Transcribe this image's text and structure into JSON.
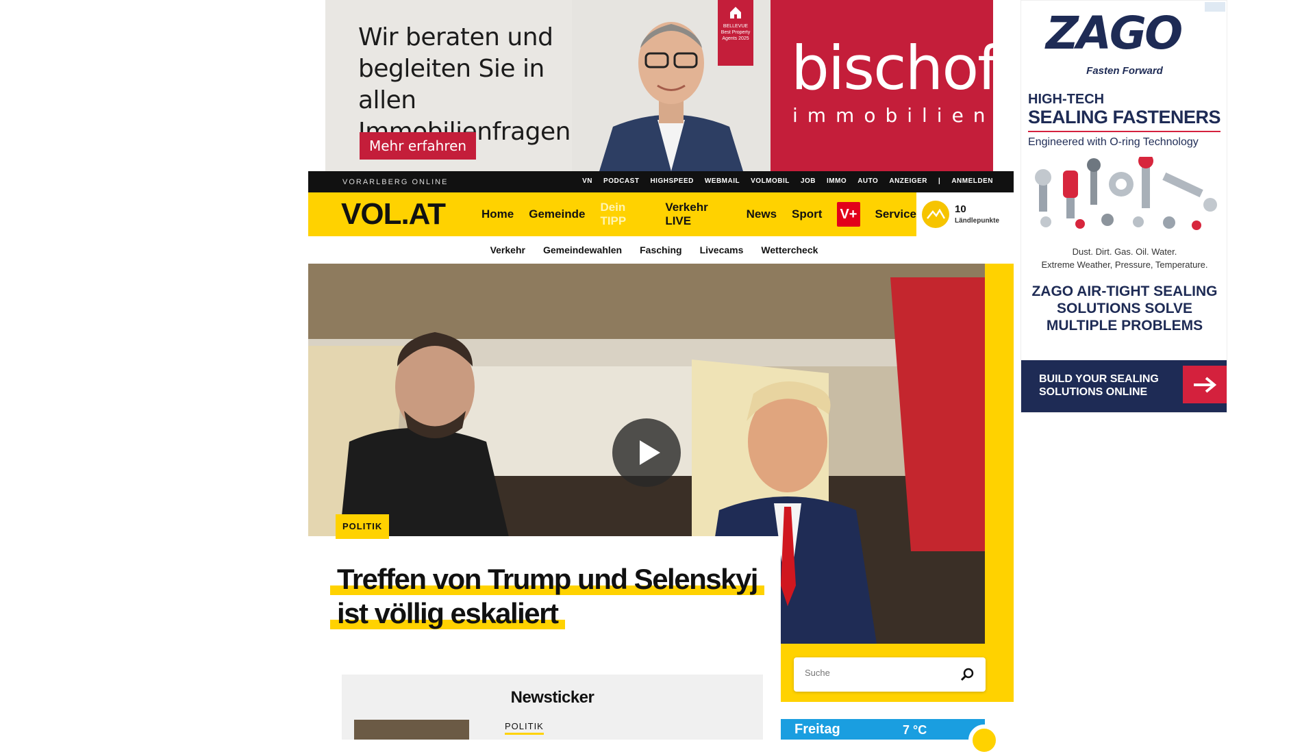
{
  "top_ad": {
    "text": "Wir beraten und begleiten Sie in allen Immobilienfragen.",
    "cta": "Mehr erfahren",
    "badge": "BELLEVUE Best Property Agents 2025",
    "brand_name": "bischof",
    "brand_sub": "immobilien"
  },
  "topbar": {
    "site_label": "VORARLBERG ONLINE",
    "links": [
      "VN",
      "PODCAST",
      "HIGHSPEED",
      "WEBMAIL",
      "VOLMOBIL",
      "JOB",
      "IMMO",
      "AUTO",
      "ANZEIGER"
    ],
    "separator": "|",
    "login": "ANMELDEN"
  },
  "nav": {
    "logo": "VOL.AT",
    "items": [
      "Home",
      "Gemeinde",
      "Dein TIPP",
      "Verkehr LIVE",
      "News",
      "Sport"
    ],
    "vplus": "V+",
    "service": "Service"
  },
  "points": {
    "value": "10",
    "label": "Ländlepunkte"
  },
  "subnav": {
    "items": [
      "Verkehr",
      "Gemeindewahlen",
      "Fasching",
      "Livecams",
      "Wettercheck"
    ]
  },
  "hero": {
    "category": "POLITIK",
    "headline": "Treffen von Trump und Selenskyj ist völlig eskaliert"
  },
  "search": {
    "placeholder": "Suche"
  },
  "newsticker": {
    "title": "Newsticker",
    "first_category": "POLITIK"
  },
  "weather": {
    "day": "Freitag",
    "temp": "7 °C"
  },
  "right_ad": {
    "logo": "ZAGO",
    "tagline": "Fasten Forward",
    "headline1": "HIGH-TECH",
    "headline2": "SEALING FASTENERS",
    "subline": "Engineered with O-ring Technology",
    "dust_line1": "Dust. Dirt. Gas. Oil. Water.",
    "dust_line2": "Extreme Weather, Pressure, Temperature.",
    "solve": "ZAGO AIR-TIGHT SEALING SOLUTIONS SOLVE MULTIPLE PROBLEMS",
    "build": "BUILD YOUR SEALING SOLUTIONS ONLINE"
  },
  "colors": {
    "brand_yellow": "#ffd200",
    "ad_red": "#c41e3a",
    "zago_navy": "#1e2b55",
    "weather_blue": "#1a9ee0"
  }
}
